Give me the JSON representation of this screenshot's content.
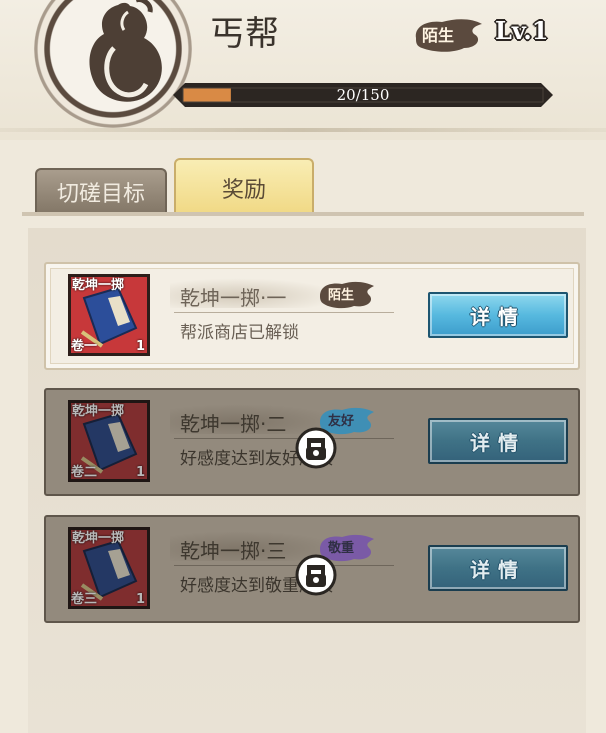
{
  "header": {
    "guild_name": "丐帮",
    "relation": "陌生",
    "level": "Lv.1",
    "xp_text": "20/150",
    "xp_fraction": 0.133
  },
  "tabs": [
    {
      "label": "切磋目标",
      "active": false
    },
    {
      "label": "奖励",
      "active": true
    }
  ],
  "rewards": [
    {
      "name": "乾坤一掷·一",
      "tag": "陌生",
      "description": "帮派商店已解锁",
      "scroll_top": "乾坤一掷",
      "scroll_bottom": "卷一",
      "scroll_count": "1",
      "button": "详情",
      "locked": false
    },
    {
      "name": "乾坤一掷·二",
      "tag": "友好",
      "description": "好感度达到友好解锁",
      "scroll_top": "乾坤一掷",
      "scroll_bottom": "卷二",
      "scroll_count": "1",
      "button": "详情",
      "locked": true
    },
    {
      "name": "乾坤一掷·三",
      "tag": "敬重",
      "description": "好感度达到敬重解锁",
      "scroll_top": "乾坤一掷",
      "scroll_bottom": "卷三",
      "scroll_count": "1",
      "button": "详情",
      "locked": true
    }
  ],
  "colors": {
    "tag_stranger": "#5b4a3e",
    "tag_friendly": "#3f8fb5",
    "tag_respect": "#7a5aa6",
    "xp_fill": "#d98a45",
    "button": "#57b9df"
  }
}
